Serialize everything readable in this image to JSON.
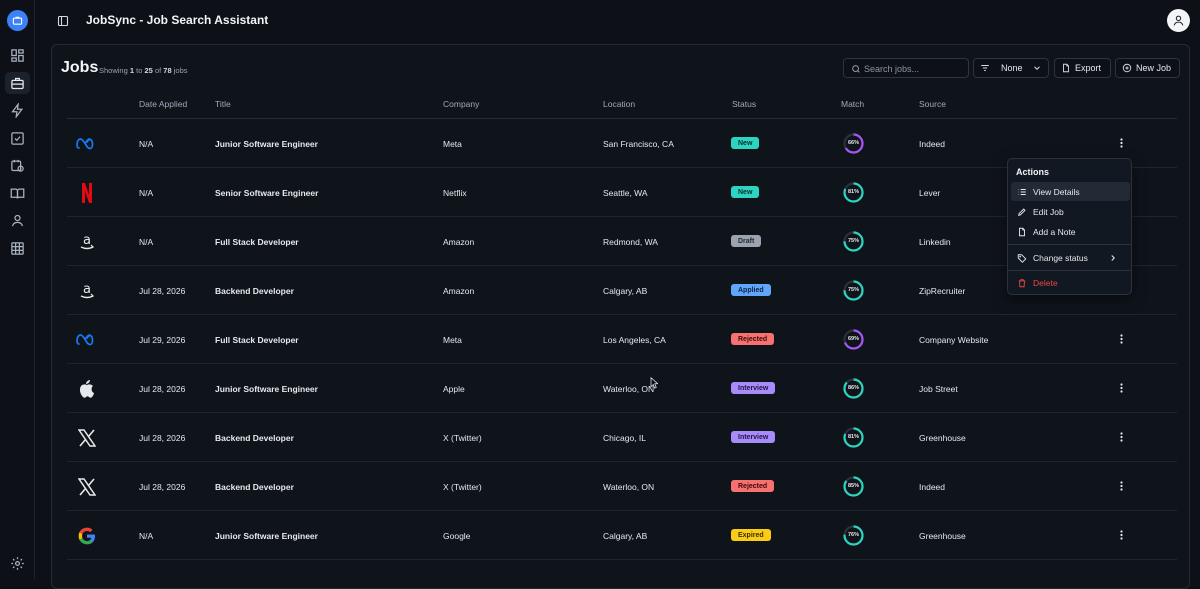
{
  "app": {
    "title": "JobSync - Job Search Assistant"
  },
  "sidebar": {
    "items": [
      {
        "icon": "dashboard-icon"
      },
      {
        "icon": "briefcase-icon",
        "active": true
      },
      {
        "icon": "lightning-icon"
      },
      {
        "icon": "checklist-icon"
      },
      {
        "icon": "calendar-clock-icon"
      },
      {
        "icon": "book-icon"
      },
      {
        "icon": "user-icon"
      },
      {
        "icon": "table-icon"
      }
    ],
    "settings_icon": "gear-icon"
  },
  "page": {
    "title": "Jobs",
    "showing_prefix": "Showing",
    "range_start": "1",
    "range_to": "to",
    "range_end": "25",
    "of_label": "of",
    "total": "78",
    "jobs_label": "jobs"
  },
  "toolbar": {
    "search_placeholder": "Search jobs...",
    "filter_label": "None",
    "export_label": "Export",
    "new_job_label": "New Job"
  },
  "table": {
    "columns": [
      "Date Applied",
      "Title",
      "Company",
      "Location",
      "Status",
      "Match",
      "Source"
    ],
    "rows": [
      {
        "logo": "meta",
        "date": "N/A",
        "title": "Junior Software Engineer",
        "company": "Meta",
        "location": "San Francisco, CA",
        "status": "New",
        "match": "66%",
        "match_value": 66,
        "source": "Indeed"
      },
      {
        "logo": "netflix",
        "date": "N/A",
        "title": "Senior Software Engineer",
        "company": "Netflix",
        "location": "Seattle, WA",
        "status": "New",
        "match": "81%",
        "match_value": 81,
        "source": "Lever"
      },
      {
        "logo": "amazon",
        "date": "N/A",
        "title": "Full Stack Developer",
        "company": "Amazon",
        "location": "Redmond, WA",
        "status": "Draft",
        "match": "75%",
        "match_value": 75,
        "source": "Linkedin"
      },
      {
        "logo": "amazon",
        "date": "Jul 28, 2026",
        "title": "Backend Developer",
        "company": "Amazon",
        "location": "Calgary, AB",
        "status": "Applied",
        "match": "75%",
        "match_value": 75,
        "source": "ZipRecruiter"
      },
      {
        "logo": "meta",
        "date": "Jul 29, 2026",
        "title": "Full Stack Developer",
        "company": "Meta",
        "location": "Los Angeles, CA",
        "status": "Rejected",
        "match": "69%",
        "match_value": 69,
        "source": "Company Website"
      },
      {
        "logo": "apple",
        "date": "Jul 28, 2026",
        "title": "Junior Software Engineer",
        "company": "Apple",
        "location": "Waterloo, ON",
        "status": "Interview",
        "match": "86%",
        "match_value": 86,
        "source": "Job Street"
      },
      {
        "logo": "x",
        "date": "Jul 28, 2026",
        "title": "Backend Developer",
        "company": "X (Twitter)",
        "location": "Chicago, IL",
        "status": "Interview",
        "match": "81%",
        "match_value": 81,
        "source": "Greenhouse"
      },
      {
        "logo": "x",
        "date": "Jul 28, 2026",
        "title": "Backend Developer",
        "company": "X (Twitter)",
        "location": "Waterloo, ON",
        "status": "Rejected",
        "match": "85%",
        "match_value": 85,
        "source": "Indeed"
      },
      {
        "logo": "google",
        "date": "N/A",
        "title": "Junior Software Engineer",
        "company": "Google",
        "location": "Calgary, AB",
        "status": "Expired",
        "match": "76%",
        "match_value": 76,
        "source": "Greenhouse"
      }
    ]
  },
  "status_colors": {
    "New": {
      "bg": "#2dd4bf",
      "fg": "#08302b"
    },
    "Draft": {
      "bg": "#9ca3af",
      "fg": "#1f2937"
    },
    "Applied": {
      "bg": "#60a5fa",
      "fg": "#0b2447"
    },
    "Rejected": {
      "bg": "#f87171",
      "fg": "#3b0a0a"
    },
    "Interview": {
      "bg": "#a78bfa",
      "fg": "#231344"
    },
    "Expired": {
      "bg": "#facc15",
      "fg": "#3a2f02"
    }
  },
  "actions_menu": {
    "title": "Actions",
    "items": [
      {
        "label": "View Details",
        "icon": "list-icon"
      },
      {
        "label": "Edit Job",
        "icon": "pencil-icon"
      },
      {
        "label": "Add a Note",
        "icon": "note-icon"
      },
      {
        "label": "Change status",
        "icon": "tag-icon"
      },
      {
        "label": "Delete",
        "icon": "trash-icon"
      }
    ]
  }
}
